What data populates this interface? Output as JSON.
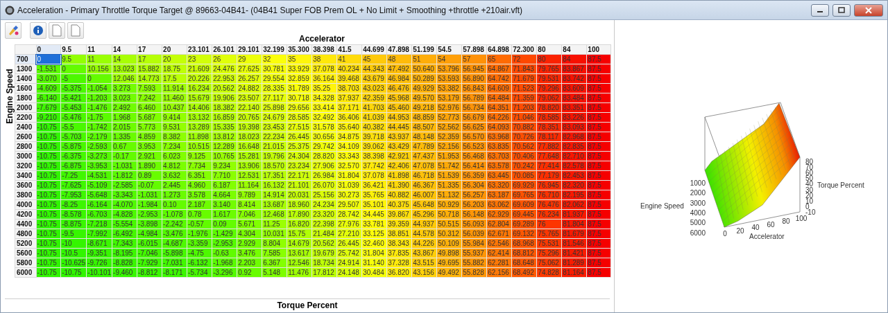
{
  "window": {
    "title": "Acceleration - Primary Throttle Torque Target @ 89663-04B41- (04B41 Super FOB Prem OL + No Limit + Smoothing +throttle +210air.vft)"
  },
  "table": {
    "column_axis": "Accelerator",
    "row_axis": "Engine Speed",
    "value_axis": "Torque Percent",
    "columns": [
      {
        "label": "0",
        "selected": true
      },
      {
        "label": "9.5",
        "selected": false
      },
      {
        "label": "11",
        "selected": false
      },
      {
        "label": "14",
        "selected": false
      },
      {
        "label": "17",
        "selected": false
      },
      {
        "label": "20",
        "selected": false
      },
      {
        "label": "23.101",
        "selected": false
      },
      {
        "label": "26.101",
        "selected": false
      },
      {
        "label": "29.101",
        "selected": false
      },
      {
        "label": "32.199",
        "selected": false
      },
      {
        "label": "35.300",
        "selected": false
      },
      {
        "label": "38.398",
        "selected": false
      },
      {
        "label": "41.5",
        "selected": false
      },
      {
        "label": "44.699",
        "selected": false
      },
      {
        "label": "47.898",
        "selected": false
      },
      {
        "label": "51.199",
        "selected": false
      },
      {
        "label": "54.5",
        "selected": false
      },
      {
        "label": "57.898",
        "selected": false
      },
      {
        "label": "64.898",
        "selected": false
      },
      {
        "label": "72.300",
        "selected": false
      },
      {
        "label": "80",
        "selected": false
      },
      {
        "label": "84",
        "selected": false
      },
      {
        "label": "100",
        "selected": false
      }
    ],
    "rows": [
      {
        "label": "700",
        "selected": true,
        "cells": [
          "0",
          "9.5",
          "11",
          "14",
          "17",
          "20",
          "23",
          "26",
          "29",
          "32",
          "35",
          "38",
          "41",
          "45",
          "48",
          "51",
          "54",
          "57",
          "65",
          "72",
          "80",
          "84",
          "87.5"
        ]
      },
      {
        "label": "1300",
        "selected": false,
        "cells": [
          "-1.531",
          "0",
          "10.156",
          "13.023",
          "15.882",
          "18.75",
          "21.609",
          "24.476",
          "27.625",
          "30.781",
          "33.929",
          "37.078",
          "40.234",
          "44.343",
          "47.492",
          "50.640",
          "53.796",
          "56.945",
          "64.867",
          "71.843",
          "79.765",
          "83.867",
          "87.5"
        ]
      },
      {
        "label": "1400",
        "selected": false,
        "cells": [
          "-3.070",
          "-5",
          "0",
          "12.046",
          "14.773",
          "17.5",
          "20.226",
          "22.953",
          "26.257",
          "29.554",
          "32.859",
          "36.164",
          "39.468",
          "43.679",
          "46.984",
          "50.289",
          "53.593",
          "56.890",
          "64.742",
          "71.679",
          "79.531",
          "83.742",
          "87.5"
        ]
      },
      {
        "label": "1600",
        "selected": false,
        "cells": [
          "-4.609",
          "-5.375",
          "-1.054",
          "3.273",
          "7.593",
          "11.914",
          "16.234",
          "20.562",
          "24.882",
          "28.335",
          "31.789",
          "35.25",
          "38.703",
          "43.023",
          "46.476",
          "49.929",
          "53.382",
          "56.843",
          "64.609",
          "71.523",
          "79.296",
          "83.609",
          "87.5"
        ]
      },
      {
        "label": "1800",
        "selected": false,
        "cells": [
          "-6.140",
          "-5.421",
          "-1.203",
          "3.023",
          "7.242",
          "11.460",
          "15.679",
          "19.906",
          "23.507",
          "27.117",
          "30.718",
          "34.328",
          "37.937",
          "42.359",
          "45.968",
          "49.570",
          "53.179",
          "56.789",
          "64.484",
          "71.359",
          "79.062",
          "83.484",
          "87.5"
        ]
      },
      {
        "label": "2000",
        "selected": false,
        "cells": [
          "-7.679",
          "-5.453",
          "-1.476",
          "2.492",
          "6.460",
          "10.437",
          "14.406",
          "18.382",
          "22.140",
          "25.898",
          "29.656",
          "33.414",
          "37.171",
          "41.703",
          "45.460",
          "49.218",
          "52.976",
          "56.734",
          "64.351",
          "71.203",
          "78.820",
          "83.351",
          "87.5"
        ]
      },
      {
        "label": "2200",
        "selected": false,
        "cells": [
          "-9.210",
          "-5.476",
          "-1.75",
          "1.968",
          "5.687",
          "9.414",
          "13.132",
          "16.859",
          "20.765",
          "24.679",
          "28.585",
          "32.492",
          "36.406",
          "41.039",
          "44.953",
          "48.859",
          "52.773",
          "56.679",
          "64.226",
          "71.046",
          "78.585",
          "83.226",
          "87.5"
        ]
      },
      {
        "label": "2400",
        "selected": false,
        "cells": [
          "-10.75",
          "-5.5",
          "-1.742",
          "2.015",
          "5.773",
          "9.531",
          "13.289",
          "15.335",
          "19.398",
          "23.453",
          "27.515",
          "31.578",
          "35.640",
          "40.382",
          "44.445",
          "48.507",
          "52.562",
          "56.625",
          "64.093",
          "70.882",
          "78.351",
          "83.093",
          "87.5"
        ]
      },
      {
        "label": "2600",
        "selected": false,
        "cells": [
          "-10.75",
          "-5.703",
          "-2.179",
          "1.335",
          "4.859",
          "8.382",
          "11.898",
          "13.812",
          "18.023",
          "22.234",
          "26.445",
          "30.656",
          "34.875",
          "39.718",
          "43.937",
          "48.148",
          "52.359",
          "56.570",
          "63.968",
          "70.726",
          "78.117",
          "82.968",
          "87.5"
        ]
      },
      {
        "label": "2800",
        "selected": false,
        "cells": [
          "-10.75",
          "-5.875",
          "-2.593",
          "0.67",
          "3.953",
          "7.234",
          "10.515",
          "12.289",
          "16.648",
          "21.015",
          "25.375",
          "29.742",
          "34.109",
          "39.062",
          "43.429",
          "47.789",
          "52.156",
          "56.523",
          "63.835",
          "70.562",
          "77.882",
          "82.835",
          "87.5"
        ]
      },
      {
        "label": "3000",
        "selected": false,
        "cells": [
          "-10.75",
          "-6.375",
          "-3.273",
          "-0.17",
          "2.921",
          "6.023",
          "9.125",
          "10.765",
          "15.281",
          "19.796",
          "24.304",
          "28.820",
          "33.343",
          "38.398",
          "42.921",
          "47.437",
          "51.953",
          "56.468",
          "63.703",
          "70.406",
          "77.648",
          "82.710",
          "87.5"
        ]
      },
      {
        "label": "3200",
        "selected": false,
        "cells": [
          "-10.75",
          "-6.875",
          "-3.953",
          "-1.031",
          "1.890",
          "4.812",
          "7.734",
          "9.234",
          "13.906",
          "18.570",
          "23.234",
          "27.906",
          "32.570",
          "37.742",
          "42.406",
          "47.078",
          "51.742",
          "56.414",
          "63.578",
          "70.242",
          "77.414",
          "82.578",
          "87.5"
        ]
      },
      {
        "label": "3400",
        "selected": false,
        "cells": [
          "-10.75",
          "-7.25",
          "-4.531",
          "-1.812",
          "0.89",
          "3.632",
          "6.351",
          "7.710",
          "12.531",
          "17.351",
          "22.171",
          "26.984",
          "31.804",
          "37.078",
          "41.898",
          "46.718",
          "51.539",
          "56.359",
          "63.445",
          "70.085",
          "77.179",
          "82.453",
          "87.5"
        ]
      },
      {
        "label": "3600",
        "selected": false,
        "cells": [
          "-10.75",
          "-7.625",
          "-5.109",
          "-2.585",
          "-0.07",
          "2.445",
          "4.960",
          "6.187",
          "11.164",
          "16.132",
          "21.101",
          "26.070",
          "31.039",
          "36.421",
          "41.390",
          "46.367",
          "51.335",
          "56.304",
          "63.320",
          "69.929",
          "76.945",
          "82.320",
          "87.5"
        ]
      },
      {
        "label": "3800",
        "selected": false,
        "cells": [
          "-10.75",
          "-7.953",
          "-5.648",
          "-3.343",
          "-1.031",
          "1.273",
          "3.578",
          "4.664",
          "9.789",
          "14.914",
          "20.031",
          "25.156",
          "30.273",
          "35.765",
          "40.882",
          "46.007",
          "51.132",
          "56.257",
          "63.187",
          "69.765",
          "76.710",
          "82.195",
          "87.5"
        ]
      },
      {
        "label": "4000",
        "selected": false,
        "cells": [
          "-10.75",
          "-8.25",
          "-6.164",
          "-4.070",
          "-1.984",
          "0.10",
          "2.187",
          "3.140",
          "8.414",
          "13.687",
          "18.960",
          "24.234",
          "29.507",
          "35.101",
          "40.375",
          "45.648",
          "50.929",
          "56.203",
          "63.062",
          "69.609",
          "76.476",
          "82.062",
          "87.5"
        ]
      },
      {
        "label": "4200",
        "selected": false,
        "cells": [
          "-10.75",
          "-8.578",
          "-6.703",
          "-4.828",
          "-2.953",
          "-1.078",
          "0.78",
          "1.617",
          "7.046",
          "12.468",
          "17.890",
          "23.320",
          "28.742",
          "34.445",
          "39.867",
          "45.296",
          "50.718",
          "56.148",
          "62.929",
          "69.445",
          "76.234",
          "81.937",
          "87.5"
        ]
      },
      {
        "label": "4400",
        "selected": false,
        "cells": [
          "-10.75",
          "-8.875",
          "-7.218",
          "-5.554",
          "-3.898",
          "-2.242",
          "-0.57",
          "0.09",
          "5.671",
          "11.25",
          "16.820",
          "22.398",
          "27.976",
          "33.781",
          "39.359",
          "44.937",
          "50.515",
          "56.093",
          "62.804",
          "69.289",
          "76",
          "81.804",
          "87.5"
        ]
      },
      {
        "label": "4800",
        "selected": false,
        "cells": [
          "-10.75",
          "-9.5",
          "-7.992",
          "-6.492",
          "-4.984",
          "-3.476",
          "-1.976",
          "-1.429",
          "4.304",
          "10.031",
          "15.75",
          "21.484",
          "27.210",
          "33.125",
          "38.851",
          "44.578",
          "50.312",
          "56.039",
          "62.671",
          "69.132",
          "75.765",
          "81.679",
          "87.5"
        ]
      },
      {
        "label": "5200",
        "selected": false,
        "cells": [
          "-10.75",
          "-10",
          "-8.671",
          "-7.343",
          "-6.015",
          "-4.687",
          "-3.359",
          "-2.953",
          "2.929",
          "8.804",
          "14.679",
          "20.562",
          "26.445",
          "32.460",
          "38.343",
          "44.226",
          "50.109",
          "55.984",
          "62.546",
          "68.968",
          "75.531",
          "81.546",
          "87.5"
        ]
      },
      {
        "label": "5600",
        "selected": false,
        "cells": [
          "-10.75",
          "-10.5",
          "-9.351",
          "-8.195",
          "-7.046",
          "-5.898",
          "-4.75",
          "-0.63",
          "3.476",
          "7.585",
          "13.617",
          "19.679",
          "25.742",
          "31.804",
          "37.835",
          "43.867",
          "49.898",
          "55.937",
          "62.414",
          "68.812",
          "75.296",
          "81.421",
          "87.5"
        ]
      },
      {
        "label": "5800",
        "selected": false,
        "cells": [
          "-10.75",
          "-10.625",
          "-9.726",
          "-8.828",
          "-7.929",
          "-7.031",
          "-6.132",
          "-1.968",
          "2.203",
          "6.367",
          "12.546",
          "18.734",
          "24.914",
          "31.140",
          "37.328",
          "43.515",
          "49.695",
          "55.882",
          "62.281",
          "68.648",
          "75.062",
          "81.289",
          "87.5"
        ]
      },
      {
        "label": "6000",
        "selected": false,
        "cells": [
          "-10.75",
          "-10.75",
          "-10.101",
          "-9.460",
          "-8.812",
          "-8.171",
          "-5.734",
          "-3.296",
          "0.92",
          "5.148",
          "11.476",
          "17.812",
          "24.148",
          "30.484",
          "36.820",
          "43.156",
          "49.492",
          "55.828",
          "62.156",
          "68.492",
          "74.828",
          "81.164",
          "87.5"
        ]
      }
    ]
  },
  "surface_plot": {
    "x_label": "Accelerator",
    "y_label": "Engine Speed",
    "z_label": "Torque Percent",
    "x_ticks": [
      "0",
      "20",
      "40",
      "60",
      "80",
      "100"
    ],
    "y_ticks": [
      "1000",
      "2000",
      "3000",
      "4000",
      "5000",
      "6000"
    ],
    "z_ticks": [
      "80",
      "70",
      "60",
      "50",
      "40",
      "30",
      "20",
      "10",
      "0",
      "-10"
    ]
  }
}
